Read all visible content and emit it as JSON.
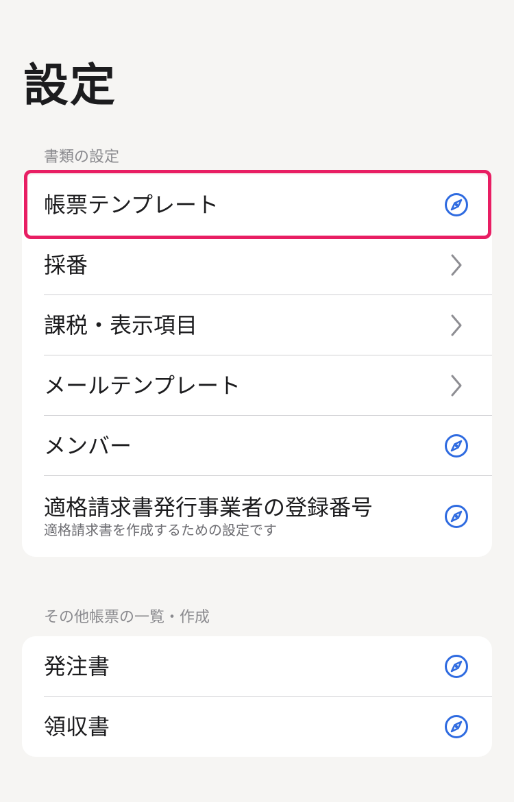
{
  "page": {
    "title": "設定"
  },
  "colors": {
    "accent": "#2f6be0",
    "chevron": "#8e8e93",
    "highlight": "#e81e63",
    "background": "#f6f5f3"
  },
  "sections": [
    {
      "header": "書類の設定",
      "items": [
        {
          "label": "帳票テンプレート",
          "accessory": "compass-icon",
          "highlighted": true
        },
        {
          "label": "採番",
          "accessory": "chevron-right-icon"
        },
        {
          "label": "課税・表示項目",
          "accessory": "chevron-right-icon"
        },
        {
          "label": "メールテンプレート",
          "accessory": "chevron-right-icon"
        },
        {
          "label": "メンバー",
          "accessory": "compass-icon"
        },
        {
          "label": "適格請求書発行事業者の登録番号",
          "sublabel": "適格請求書を作成するための設定です",
          "accessory": "compass-icon"
        }
      ]
    },
    {
      "header": "その他帳票の一覧・作成",
      "items": [
        {
          "label": "発注書",
          "accessory": "compass-icon"
        },
        {
          "label": "領収書",
          "accessory": "compass-icon"
        }
      ]
    }
  ]
}
